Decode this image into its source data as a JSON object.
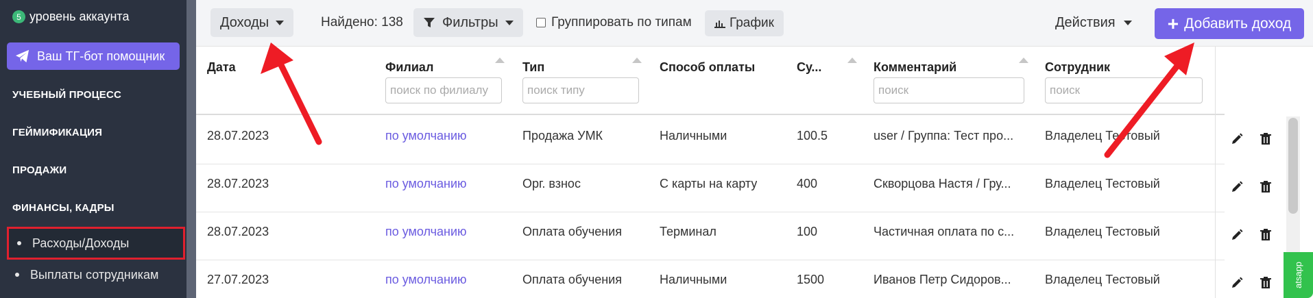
{
  "sidebar": {
    "level_badge": "5",
    "level_label": "уровень аккаунта",
    "bot_button": "Ваш ТГ-бот помощник",
    "sections": [
      "УЧЕБНЫЙ ПРОЦЕСС",
      "ГЕЙМИФИКАЦИЯ",
      "ПРОДАЖИ",
      "ФИНАНСЫ, КАДРЫ"
    ],
    "subitems": [
      "Расходы/Доходы",
      "Выплаты сотрудникам"
    ],
    "active_subitem": "Расходы/Доходы"
  },
  "toolbar": {
    "type_select": "Доходы",
    "found": "Найдено: 138",
    "filters": "Фильтры",
    "group_label": "Группировать по типам",
    "group_checked": false,
    "chart": "График",
    "actions": "Действия",
    "add": "Добавить доход"
  },
  "table": {
    "headers": [
      "Дата",
      "Филиал",
      "Тип",
      "Способ оплаты",
      "Су...",
      "Комментарий",
      "Сотрудник"
    ],
    "filters": {
      "branch_placeholder": "поиск по филиалу",
      "type_placeholder": "поиск типу",
      "comment_placeholder": "поиск",
      "employee_placeholder": "поиск"
    },
    "rows": [
      {
        "date": "28.07.2023",
        "branch": "по умолчанию",
        "type": "Продажа УМК",
        "payment": "Наличными",
        "sum": "100.5",
        "comment": "user / Группа: Тест про...",
        "employee": "Владелец Тестовый"
      },
      {
        "date": "28.07.2023",
        "branch": "по умолчанию",
        "type": "Орг. взнос",
        "payment": "С карты на карту",
        "sum": "400",
        "comment": "Скворцова Настя / Гру...",
        "employee": "Владелец Тестовый"
      },
      {
        "date": "28.07.2023",
        "branch": "по умолчанию",
        "type": "Оплата обучения",
        "payment": "Терминал",
        "sum": "100",
        "comment": "Частичная оплата по с...",
        "employee": "Владелец Тестовый"
      },
      {
        "date": "27.07.2023",
        "branch": "по умолчанию",
        "type": "Оплата обучения",
        "payment": "Наличными",
        "sum": "1500",
        "comment": "Иванов Петр Сидоров...",
        "employee": "Владелец Тестовый"
      }
    ]
  },
  "whatsapp_tab": "atsapp",
  "colors": {
    "sidebar_bg": "#2b3240",
    "accent": "#7565e8",
    "highlight": "#e0202e",
    "link": "#6a5be0",
    "whatsapp": "#32c24d"
  }
}
